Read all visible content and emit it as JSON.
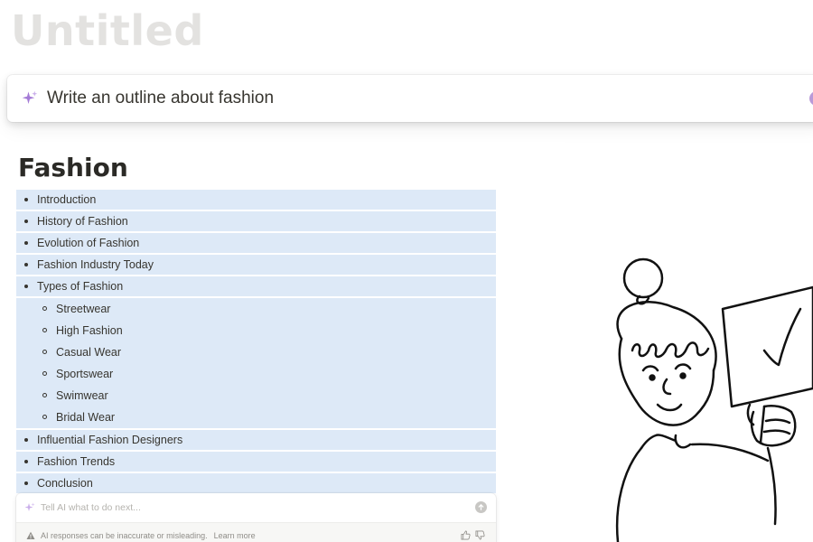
{
  "page": {
    "title": "Untitled"
  },
  "prompt": {
    "text": "Write an outline about fashion"
  },
  "document": {
    "heading": "Fashion",
    "items": [
      {
        "label": "Introduction"
      },
      {
        "label": "History of Fashion"
      },
      {
        "label": "Evolution of Fashion"
      },
      {
        "label": "Fashion Industry Today"
      },
      {
        "label": "Types of Fashion",
        "children": [
          {
            "label": "Streetwear"
          },
          {
            "label": "High Fashion"
          },
          {
            "label": "Casual Wear"
          },
          {
            "label": "Sportswear"
          },
          {
            "label": "Swimwear"
          },
          {
            "label": "Bridal Wear"
          }
        ]
      },
      {
        "label": "Influential Fashion Designers"
      },
      {
        "label": "Fashion Trends"
      },
      {
        "label": "Conclusion"
      }
    ]
  },
  "ai_panel": {
    "placeholder": "Tell AI what to do next...",
    "disclaimer": "AI responses can be inaccurate or misleading.",
    "learn_more": "Learn more"
  },
  "icons": {
    "sparkle": "sparkle-icon",
    "warning": "warning-icon",
    "submit": "arrow-up-icon",
    "like": "thumbs-up-icon",
    "dislike": "thumbs-down-icon"
  },
  "colors": {
    "accent": "#a47bd6",
    "selection": "#dde9f7",
    "title_placeholder": "#e3e2e0"
  }
}
